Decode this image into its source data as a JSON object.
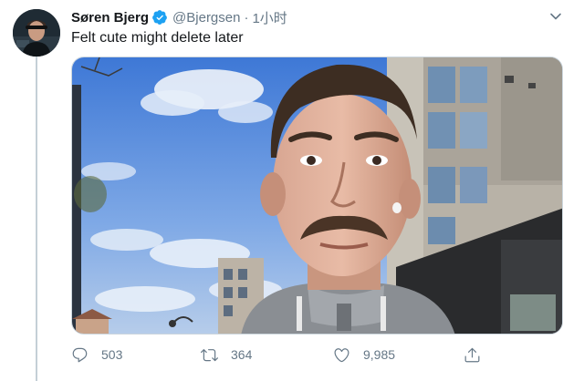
{
  "tweet": {
    "author_name": "Søren Bjerg",
    "author_handle": "@Bjergsen",
    "separator": "·",
    "time": "1小时",
    "text": "Felt cute might delete later",
    "verified": true,
    "icons": {
      "avatar": "avatar",
      "verified": "verified-badge-icon",
      "menu": "chevron-down-icon",
      "reply": "reply-icon",
      "retweet": "retweet-icon",
      "like": "heart-icon",
      "share": "share-icon"
    },
    "stats": {
      "replies": "503",
      "retweets": "364",
      "likes": "9,985"
    }
  },
  "colors": {
    "verified": "#1da1f2",
    "secondary_text": "#657786",
    "icon": "#657786",
    "primary_text": "#14171a",
    "thread_line": "#c4cfd6"
  }
}
